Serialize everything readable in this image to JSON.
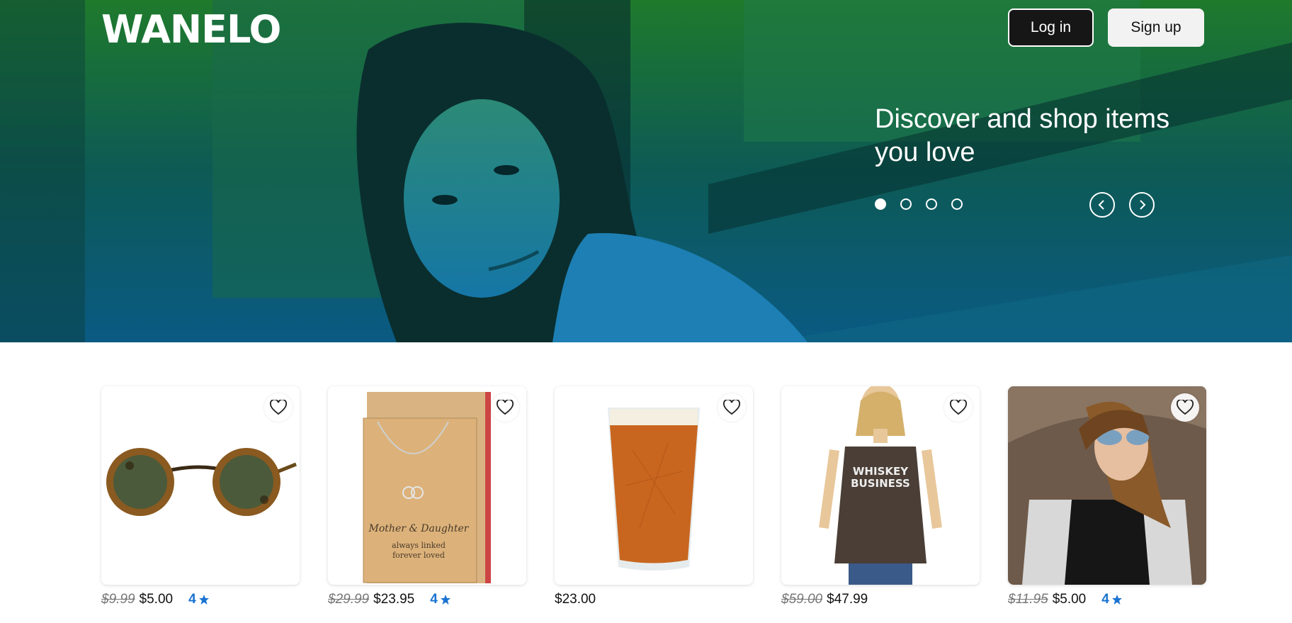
{
  "header": {
    "logo": "WANELO",
    "login_label": "Log in",
    "signup_label": "Sign up"
  },
  "hero": {
    "tagline": "Discover and shop items you love",
    "slide_count": 4,
    "active_slide": 0
  },
  "colors": {
    "hero_gradient_top": "#1d6e2c",
    "hero_gradient_bottom": "#0b5f86",
    "rating_blue": "#1a73d0"
  },
  "products": [
    {
      "name": "round-sunglasses",
      "old_price": "$9.99",
      "price": "$5.00",
      "rating": "4"
    },
    {
      "name": "mother-daughter-necklace",
      "old_price": "$29.99",
      "price": "$23.95",
      "rating": "4"
    },
    {
      "name": "beer-pint-glass",
      "old_price": "",
      "price": "$23.00",
      "rating": ""
    },
    {
      "name": "whiskey-business-tank",
      "old_price": "$59.00",
      "price": "$47.99",
      "rating": ""
    },
    {
      "name": "aviator-sunglasses-model",
      "old_price": "$11.95",
      "price": "$5.00",
      "rating": "4"
    }
  ],
  "card_text": {
    "necklace_line1": "Mother & Daughter",
    "necklace_line2": "always linked",
    "necklace_line3": "forever loved",
    "tank_line1": "WHISKEY",
    "tank_line2": "BUSINESS"
  },
  "icons": [
    "heart-icon",
    "star-icon",
    "chevron-left-icon",
    "chevron-right-icon"
  ]
}
